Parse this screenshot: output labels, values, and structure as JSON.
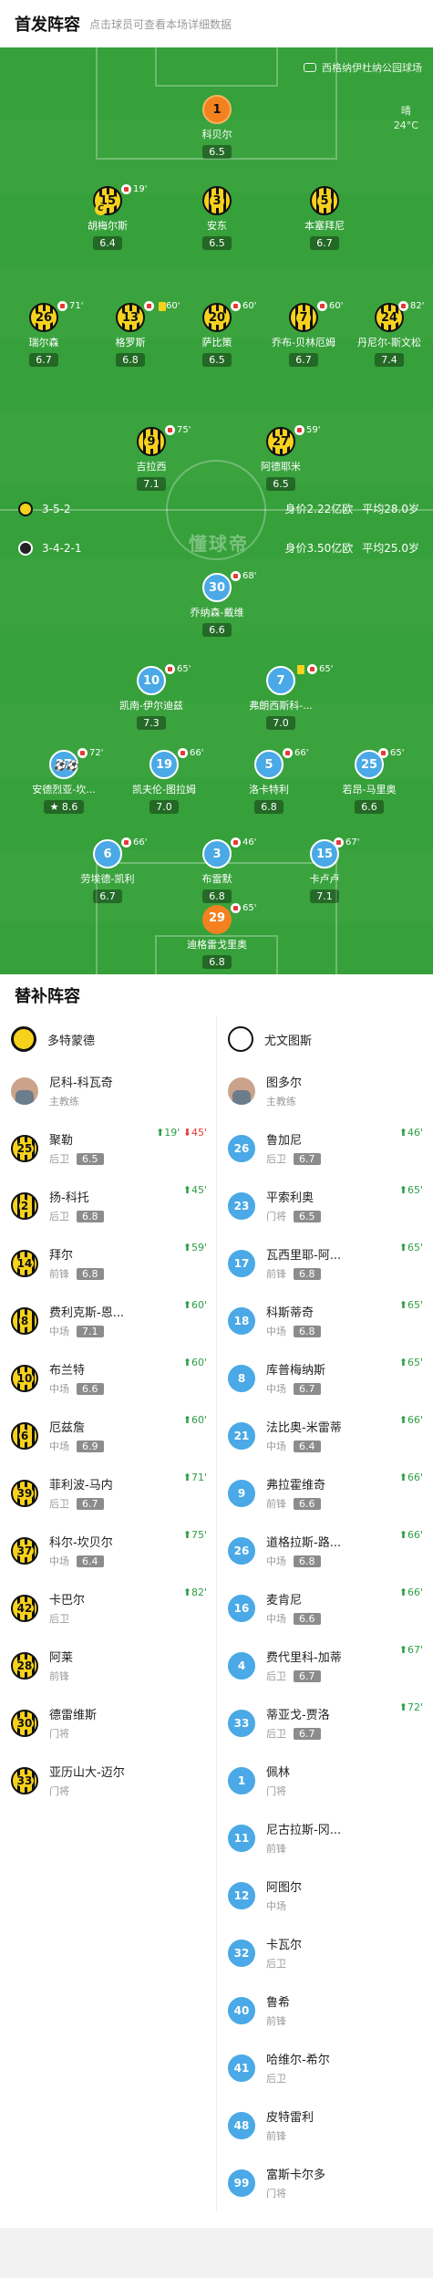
{
  "header": {
    "title": "首发阵容",
    "subtitle": "点击球员可查看本场详细数据"
  },
  "pitch": {
    "venue": "西格纳伊杜纳公园球场",
    "weather": "晴",
    "temperature": "24°C",
    "watermark": "懂球帝",
    "home": {
      "formation": "3-5-2",
      "value": "身价2.22亿欧",
      "age": "平均28.0岁"
    },
    "away": {
      "formation": "3-4-2-1",
      "value": "身价3.50亿欧",
      "age": "平均25.0岁"
    }
  },
  "home_players": [
    {
      "num": "1",
      "name": "科贝尔",
      "rating": "6.5",
      "sub": ""
    },
    {
      "num": "15",
      "name": "胡梅尔斯",
      "rating": "6.4",
      "sub": "19'"
    },
    {
      "num": "3",
      "name": "安东",
      "rating": "6.5",
      "sub": ""
    },
    {
      "num": "5",
      "name": "本塞拜尼",
      "rating": "6.7",
      "sub": ""
    },
    {
      "num": "26",
      "name": "瑞尔森",
      "rating": "6.7",
      "sub": "71'"
    },
    {
      "num": "13",
      "name": "格罗斯",
      "rating": "6.8",
      "sub": "60'"
    },
    {
      "num": "20",
      "name": "萨比策",
      "rating": "6.5",
      "sub": "60'"
    },
    {
      "num": "7",
      "name": "乔布-贝林厄姆",
      "rating": "6.7",
      "sub": "60'"
    },
    {
      "num": "24",
      "name": "丹尼尔-斯文松",
      "rating": "7.4",
      "sub": "82'"
    },
    {
      "num": "9",
      "name": "吉拉西",
      "rating": "7.1",
      "sub": "75'"
    },
    {
      "num": "27",
      "name": "阿德耶米",
      "rating": "6.5",
      "sub": "59'"
    }
  ],
  "away_players": [
    {
      "num": "30",
      "name": "乔纳森-戴维",
      "rating": "6.6",
      "sub": "68'"
    },
    {
      "num": "10",
      "name": "凯南-伊尔迪兹",
      "rating": "7.3",
      "sub": "65'"
    },
    {
      "num": "7",
      "name": "弗朗西斯科-...",
      "rating": "7.0",
      "sub": "65'"
    },
    {
      "num": "27",
      "name": "安德烈亚-坎...",
      "rating": "8.6",
      "sub": "72'"
    },
    {
      "num": "19",
      "name": "凯夫伦-图拉姆",
      "rating": "7.0",
      "sub": "66'"
    },
    {
      "num": "5",
      "name": "洛卡特利",
      "rating": "6.8",
      "sub": "66'"
    },
    {
      "num": "25",
      "name": "若昂-马里奥",
      "rating": "6.6",
      "sub": "65'"
    },
    {
      "num": "6",
      "name": "劳埃德-凯利",
      "rating": "6.7",
      "sub": "66'"
    },
    {
      "num": "3",
      "name": "布雷默",
      "rating": "6.8",
      "sub": "46'"
    },
    {
      "num": "15",
      "name": "卡卢卢",
      "rating": "7.1",
      "sub": "67'"
    },
    {
      "num": "29",
      "name": "迪格雷戈里奥",
      "rating": "6.8",
      "sub": "65'"
    }
  ],
  "subs": {
    "title": "替补阵容",
    "home_team": "多特蒙德",
    "away_team": "尤文图斯",
    "home_coach": {
      "name": "尼科-科瓦奇",
      "role": "主教练"
    },
    "away_coach": {
      "name": "图多尔",
      "role": "主教练"
    },
    "home": [
      {
        "num": "25",
        "name": "聚勒",
        "pos": "后卫",
        "rating": "6.5",
        "in": "19'",
        "out": "45'"
      },
      {
        "num": "2",
        "name": "扬-科托",
        "pos": "后卫",
        "rating": "6.8",
        "in": "45'",
        "out": ""
      },
      {
        "num": "14",
        "name": "拜尔",
        "pos": "前锋",
        "rating": "6.8",
        "in": "59'",
        "out": ""
      },
      {
        "num": "8",
        "name": "费利克斯-恩...",
        "pos": "中场",
        "rating": "7.1",
        "in": "60'",
        "out": ""
      },
      {
        "num": "10",
        "name": "布兰特",
        "pos": "中场",
        "rating": "6.6",
        "in": "60'",
        "out": ""
      },
      {
        "num": "6",
        "name": "厄兹詹",
        "pos": "中场",
        "rating": "6.9",
        "in": "60'",
        "out": ""
      },
      {
        "num": "39",
        "name": "菲利波-马内",
        "pos": "后卫",
        "rating": "6.7",
        "in": "71'",
        "out": ""
      },
      {
        "num": "37",
        "name": "科尔-坎贝尔",
        "pos": "中场",
        "rating": "6.4",
        "in": "75'",
        "out": ""
      },
      {
        "num": "42",
        "name": "卡巴尔",
        "pos": "后卫",
        "rating": "",
        "in": "82'",
        "out": ""
      },
      {
        "num": "28",
        "name": "阿莱",
        "pos": "前锋",
        "rating": "",
        "in": "",
        "out": ""
      },
      {
        "num": "30",
        "name": "德雷维斯",
        "pos": "门将",
        "rating": "",
        "in": "",
        "out": ""
      },
      {
        "num": "33",
        "name": "亚历山大-迈尔",
        "pos": "门将",
        "rating": "",
        "in": "",
        "out": ""
      }
    ],
    "away": [
      {
        "num": "26",
        "name": "鲁加尼",
        "pos": "后卫",
        "rating": "6.7",
        "in": "46'"
      },
      {
        "num": "23",
        "name": "平索利奥",
        "pos": "门将",
        "rating": "6.5",
        "in": "65'"
      },
      {
        "num": "17",
        "name": "瓦西里耶-阿...",
        "pos": "前锋",
        "rating": "6.8",
        "in": "65'"
      },
      {
        "num": "18",
        "name": "科斯蒂奇",
        "pos": "中场",
        "rating": "6.8",
        "in": "65'"
      },
      {
        "num": "8",
        "name": "库普梅纳斯",
        "pos": "中场",
        "rating": "6.7",
        "in": "65'"
      },
      {
        "num": "21",
        "name": "法比奥-米雷蒂",
        "pos": "中场",
        "rating": "6.4",
        "in": "66'"
      },
      {
        "num": "9",
        "name": "弗拉霍维奇",
        "pos": "前锋",
        "rating": "6.6",
        "in": "66'"
      },
      {
        "num": "26",
        "name": "道格拉斯-路...",
        "pos": "中场",
        "rating": "6.8",
        "in": "66'"
      },
      {
        "num": "16",
        "name": "麦肯尼",
        "pos": "中场",
        "rating": "6.6",
        "in": "66'"
      },
      {
        "num": "4",
        "name": "费代里科-加蒂",
        "pos": "后卫",
        "rating": "6.7",
        "in": "67'"
      },
      {
        "num": "33",
        "name": "蒂亚戈-贾洛",
        "pos": "后卫",
        "rating": "6.7",
        "in": "72'"
      },
      {
        "num": "1",
        "name": "佩林",
        "pos": "门将",
        "rating": "",
        "in": ""
      },
      {
        "num": "11",
        "name": "尼古拉斯-冈...",
        "pos": "前锋",
        "rating": "",
        "in": ""
      },
      {
        "num": "12",
        "name": "阿图尔",
        "pos": "中场",
        "rating": "",
        "in": ""
      },
      {
        "num": "32",
        "name": "卡瓦尔",
        "pos": "后卫",
        "rating": "",
        "in": ""
      },
      {
        "num": "40",
        "name": "鲁希",
        "pos": "前锋",
        "rating": "",
        "in": ""
      },
      {
        "num": "41",
        "name": "哈维尔-希尔",
        "pos": "后卫",
        "rating": "",
        "in": ""
      },
      {
        "num": "48",
        "name": "皮特雷利",
        "pos": "前锋",
        "rating": "",
        "in": ""
      },
      {
        "num": "99",
        "name": "富斯卡尔多",
        "pos": "门将",
        "rating": "",
        "in": ""
      }
    ]
  },
  "colors": {
    "pitch": "#3aa33e",
    "home": "#f7d21d",
    "away": "#4aa9e6",
    "sub_in": "#2e9e45",
    "sub_out": "#e53935"
  }
}
